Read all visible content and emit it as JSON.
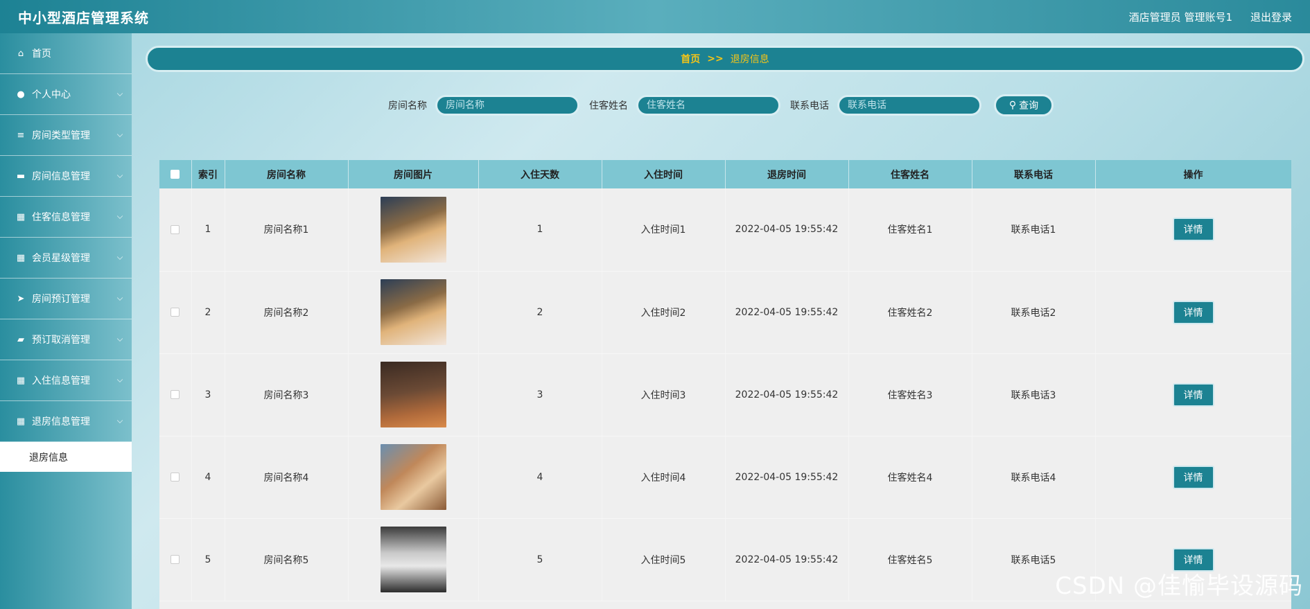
{
  "header": {
    "title": "中小型酒店管理系统",
    "user_label": "酒店管理员 管理账号1",
    "logout_label": "退出登录"
  },
  "sidebar": {
    "items": [
      {
        "label": "首页",
        "icon": "home-icon"
      },
      {
        "label": "个人中心",
        "icon": "user-icon"
      },
      {
        "label": "房间类型管理",
        "icon": "sliders-icon"
      },
      {
        "label": "房间信息管理",
        "icon": "monitor-icon"
      },
      {
        "label": "住客信息管理",
        "icon": "grid-icon"
      },
      {
        "label": "会员星级管理",
        "icon": "grid-icon"
      },
      {
        "label": "房间预订管理",
        "icon": "send-icon"
      },
      {
        "label": "预订取消管理",
        "icon": "ticket-icon"
      },
      {
        "label": "入住信息管理",
        "icon": "grid-icon"
      },
      {
        "label": "退房信息管理",
        "icon": "grid-icon"
      }
    ],
    "sub_item": "退房信息"
  },
  "breadcrumb": {
    "home": "首页",
    "separator": ">>",
    "current": "退房信息"
  },
  "search": {
    "room_name_label": "房间名称",
    "room_name_placeholder": "房间名称",
    "guest_name_label": "住客姓名",
    "guest_name_placeholder": "住客姓名",
    "phone_label": "联系电话",
    "phone_placeholder": "联系电话",
    "query_label": "查询"
  },
  "table": {
    "columns": [
      "索引",
      "房间名称",
      "房间图片",
      "入住天数",
      "入住时间",
      "退房时间",
      "住客姓名",
      "联系电话",
      "操作"
    ],
    "rows": [
      {
        "index": "1",
        "room_name": "房间名称1",
        "days": "1",
        "checkin": "入住时间1",
        "checkout": "2022-04-05 19:55:42",
        "guest": "住客姓名1",
        "phone": "联系电话1",
        "action": "详情"
      },
      {
        "index": "2",
        "room_name": "房间名称2",
        "days": "2",
        "checkin": "入住时间2",
        "checkout": "2022-04-05 19:55:42",
        "guest": "住客姓名2",
        "phone": "联系电话2",
        "action": "详情"
      },
      {
        "index": "3",
        "room_name": "房间名称3",
        "days": "3",
        "checkin": "入住时间3",
        "checkout": "2022-04-05 19:55:42",
        "guest": "住客姓名3",
        "phone": "联系电话3",
        "action": "详情"
      },
      {
        "index": "4",
        "room_name": "房间名称4",
        "days": "4",
        "checkin": "入住时间4",
        "checkout": "2022-04-05 19:55:42",
        "guest": "住客姓名4",
        "phone": "联系电话4",
        "action": "详情"
      },
      {
        "index": "5",
        "room_name": "房间名称5",
        "days": "5",
        "checkin": "入住时间5",
        "checkout": "2022-04-05 19:55:42",
        "guest": "住客姓名5",
        "phone": "联系电话5",
        "action": "详情"
      }
    ]
  },
  "watermark": "CSDN @佳愉毕设源码",
  "colors": {
    "primary": "#1c8292",
    "header_bg": "#7ec6d2",
    "breadcrumb_text": "#f5c518"
  }
}
